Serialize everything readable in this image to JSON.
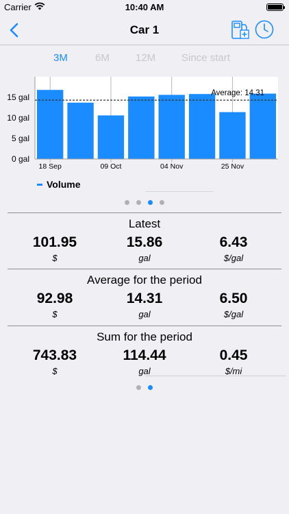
{
  "status_bar": {
    "carrier": "Carrier",
    "time": "10:40 AM"
  },
  "nav": {
    "title": "Car 1",
    "back_icon": "chevron-left-icon",
    "actions": [
      "fuel-pump-add-icon",
      "clock-icon"
    ]
  },
  "accent_color": "#1A8CFF",
  "period_tabs": [
    {
      "label": "3M",
      "active": true
    },
    {
      "label": "6M",
      "active": false
    },
    {
      "label": "12M",
      "active": false
    },
    {
      "label": "Since start",
      "active": false
    }
  ],
  "chart_data": {
    "type": "bar",
    "series_name": "Volume",
    "unit": "gal",
    "values": [
      16.8,
      13.7,
      10.6,
      15.2,
      15.6,
      15.8,
      11.4,
      15.9
    ],
    "x_tick_labels": [
      "18 Sep",
      "09 Oct",
      "04 Nov",
      "25 Nov"
    ],
    "y_ticks": [
      {
        "value": 0,
        "label": "0 gal"
      },
      {
        "value": 5,
        "label": "5 gal"
      },
      {
        "value": 10,
        "label": "10 gal"
      },
      {
        "value": 15,
        "label": "15 gal"
      }
    ],
    "ylim": [
      0,
      20
    ],
    "average": 14.31,
    "average_label": "Average: 14.31",
    "bar_color": "#1A8CFF"
  },
  "legend": {
    "label": "Volume"
  },
  "chart_pages": {
    "count": 4,
    "active": 2
  },
  "sections": [
    {
      "title": "Latest",
      "stats": [
        {
          "value": "101.95",
          "unit": "$"
        },
        {
          "value": "15.86",
          "unit": "gal"
        },
        {
          "value": "6.43",
          "unit": "$/gal"
        }
      ]
    },
    {
      "title": "Average for the period",
      "stats": [
        {
          "value": "92.98",
          "unit": "$"
        },
        {
          "value": "14.31",
          "unit": "gal"
        },
        {
          "value": "6.50",
          "unit": "$/gal"
        }
      ]
    },
    {
      "title": "Sum for the period",
      "stats": [
        {
          "value": "743.83",
          "unit": "$"
        },
        {
          "value": "114.44",
          "unit": "gal"
        },
        {
          "value": "0.45",
          "unit": "$/mi"
        }
      ]
    }
  ],
  "stats_pages": {
    "count": 2,
    "active": 1
  }
}
